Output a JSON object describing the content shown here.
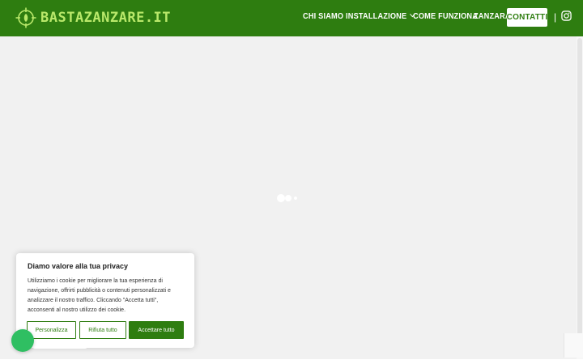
{
  "header": {
    "logo_text": "BASTAZANZARE.IT",
    "background_color": "#2e7d10",
    "logo_color": "#b9e86a",
    "logo_icon": "crosshair-leaf-icon"
  },
  "nav": {
    "items": [
      {
        "label": "CHI SIAMO"
      },
      {
        "label": "INSTALLAZIONE",
        "has_dropdown": true
      },
      {
        "label": "COME FUNZIONA"
      },
      {
        "label": "ZANZARA"
      }
    ],
    "contact_label": "CONTATTI",
    "separator": "|",
    "social_icon": "instagram-icon"
  },
  "main": {
    "loader_icon": "loading-dots-icon"
  },
  "cookie_banner": {
    "title": "Diamo valore alla tua privacy",
    "lines": [
      "Utilizziamo i cookie per migliorare la tua esperienza di",
      "navigazione, offrirti pubblicità o contenuti personalizzati e",
      "analizzare il nostro traffico. Cliccando \"Accetta tutti\",",
      "acconsenti al nostro utilizzo dei cookie."
    ],
    "customize_label": "Personalizza",
    "reject_label": "Rifiuta tutto",
    "accept_label": "Accettare tutto",
    "accent_color": "#2e7d10"
  },
  "widgets": {
    "chat_icon": "whatsapp-icon",
    "chat_color": "#2fbf62"
  }
}
